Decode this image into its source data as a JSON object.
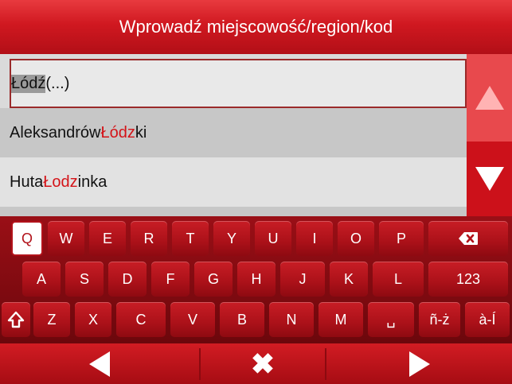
{
  "title": "Wprowadź miejscowość/region/kod",
  "input": {
    "highlight": "Łódź",
    "rest": " (...)"
  },
  "results": [
    {
      "pre": "Aleksandrów ",
      "hl": "Łódz",
      "post": "ki"
    },
    {
      "pre": "Huta ",
      "hl": "Łodz",
      "post": "inka"
    }
  ],
  "scroll": {
    "up_icon": "arrow-up-icon",
    "down_icon": "arrow-down-icon"
  },
  "keyboard": {
    "row1": [
      "Q",
      "W",
      "E",
      "R",
      "T",
      "Y",
      "U",
      "I",
      "O",
      "P"
    ],
    "row2": [
      "A",
      "S",
      "D",
      "F",
      "G",
      "H",
      "J",
      "K",
      "L",
      "123"
    ],
    "row3": [
      "Z",
      "X",
      "C",
      "V",
      "B",
      "N",
      "M",
      "␣",
      "ñ-ż",
      "à-Í"
    ],
    "backspace_icon": "backspace-icon",
    "shift_icon": "shift-icon"
  },
  "navbar": {
    "back_icon": "back-arrow-icon",
    "cancel_icon": "close-icon",
    "forward_icon": "forward-arrow-icon"
  },
  "colors": {
    "accent": "#d01820",
    "highlight_text": "#d41318"
  }
}
